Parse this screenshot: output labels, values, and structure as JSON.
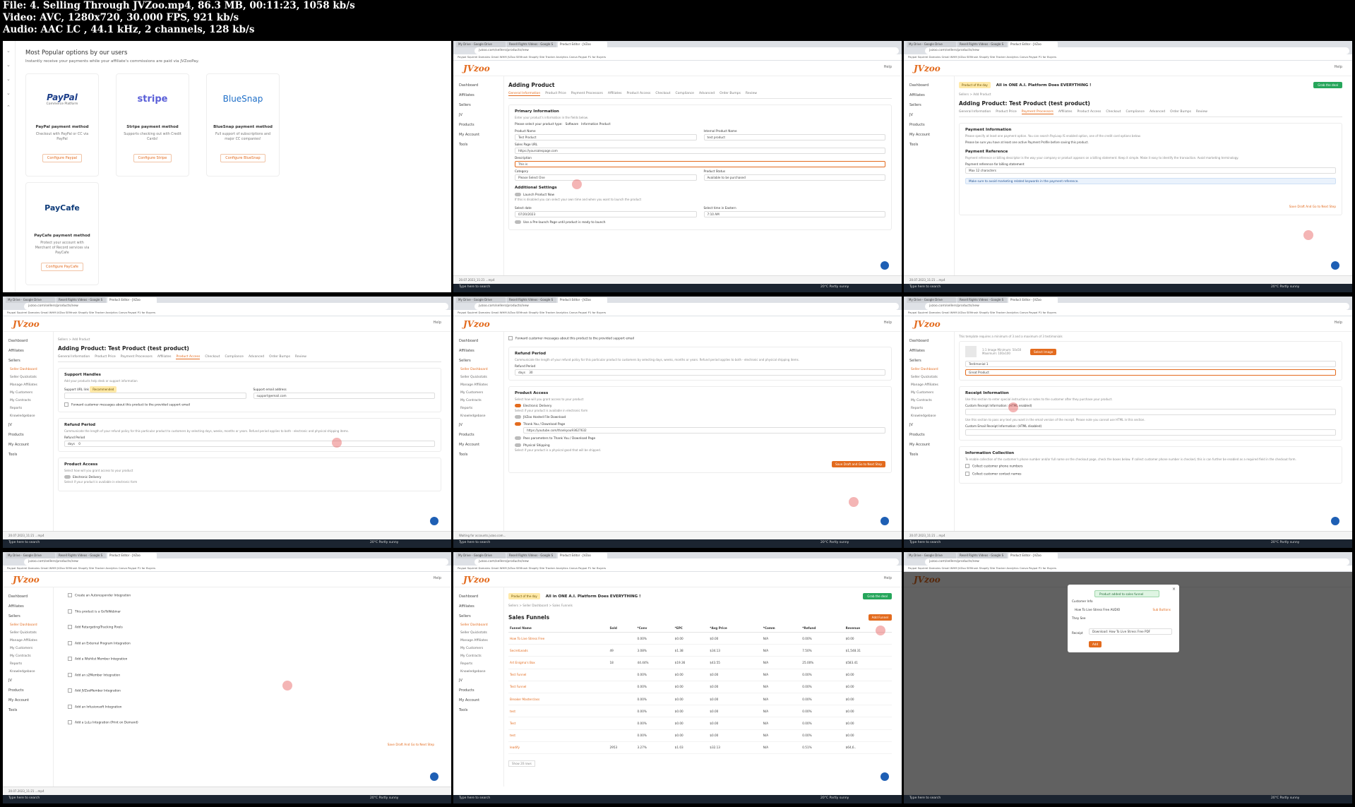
{
  "header": {
    "line1": "File: 4. Selling Through JVZoo.mp4, 86.3 MB, 00:11:23, 1058 kb/s",
    "line2": "Video: AVC, 1280x720, 30.000 FPS, 921 kb/s",
    "line3": "Audio: AAC LC , 44.1 kHz, 2 channels, 128 kb/s"
  },
  "colors": {
    "accent": "#e36b1e",
    "fab": "#1e5fb4",
    "green": "#26a65b"
  },
  "chrome": {
    "tab1": "My Drive - Google Drive",
    "tab2": "Resell Rights Videos - Google S",
    "tab3": "Product Editor - JVZoo",
    "url": "jvzoo.com/sellers/products/new",
    "bookmarks": "Paypal   Squirrel Domains   Gmail   WHM   JVZoo   SEMrush   Shopify   Site Tracker   Analytics   Canva   Paypal P1 for Buyers"
  },
  "app": {
    "logo": "JVzoo",
    "help": "Help"
  },
  "sidebar": {
    "dashboard": "Dashboard",
    "affiliates": "Affiliates",
    "sellers": "Sellers",
    "seller_dashboard": "Seller Dashboard",
    "seller_quickstats": "Seller Quickstats",
    "manage_affiliates": "Manage Affiliates",
    "my_customers": "My Customers",
    "my_contracts": "My Contracts",
    "reports": "Reports",
    "knowledgebase": "Knowledgebase",
    "jv": "JV",
    "products": "Products",
    "my_account": "My Account",
    "tools": "Tools"
  },
  "taskbar": {
    "search": "Type here to search",
    "weather": "20°C  Partly sunny"
  },
  "dlbar": "20.07.2023_11:21 ...mp4",
  "tile1": {
    "title": "Most Popular options by our users",
    "subtitle": "Instantly receive your payments while your affiliate's commissions are paid via JVZooPay.",
    "cards": [
      {
        "logo": "PayPal",
        "logo_sub": "Commerce Platform",
        "name": "PayPal payment method",
        "desc": "Checkout with PayPal or CC via PayPal",
        "cta": "Configure Paypal"
      },
      {
        "logo": "stripe",
        "name": "Stripe payment method",
        "desc": "Supports checking out with Credit Cards!",
        "cta": "Configure Stripe"
      },
      {
        "logo": "BlueSnap",
        "name": "BlueSnap payment method",
        "desc": "Full support of subscriptions and major CC companies!",
        "cta": "Configure BlueSnap"
      },
      {
        "logo": "PayCafe",
        "name": "PayCafe payment method",
        "desc": "Protect your account with Merchant of Record services via PayCafe",
        "cta": "Configure PayCafe"
      }
    ]
  },
  "tile2": {
    "page_title": "Adding Product",
    "tabs": [
      "General Information",
      "Product Price",
      "Payment Processors",
      "Affiliates",
      "Product Access",
      "Checkout",
      "Compliance",
      "Advanced",
      "Order Bumps",
      "Review"
    ],
    "section": "Primary Information",
    "section_desc": "Enter your product's information in the fields below.",
    "product_type_label": "Please select your product type:",
    "type_software": "Software",
    "type_information": "Information Product",
    "product_name_label": "Product Name",
    "product_name": "Test Product",
    "internal_name_label": "Internal Product Name",
    "internal_name": "test product",
    "sales_url_label": "Sales Page URL",
    "sales_url": "https://yoursalespage.com",
    "description_label": "Description",
    "description": "This is",
    "category_label": "Category",
    "category": "Please Select One",
    "status_label": "Product Status",
    "status": "Available to be purchased",
    "additional": "Additional Settings",
    "launch_now": "Launch Product Now",
    "launch_desc": "If this is disabled you can select your own time and when you want to launch the product",
    "date_label": "Select date",
    "date": "07/20/2023",
    "time_label": "Select time in Eastern",
    "time": "7:10 AM",
    "prelaunch": "Use a Pre-launch Page until product is ready to launch"
  },
  "tile3": {
    "badge": "Product of the day",
    "banner": "All in ONE A.I. Platform Does EVERYTHING !",
    "banner_btn": "Grab the deal",
    "crumb": "Sellers  >  Add Product",
    "page_title": "Adding Product: Test Product (test product)",
    "tabs": [
      "General Information",
      "Product Price",
      "Payment Processors",
      "Affiliates",
      "Product Access",
      "Checkout",
      "Compliance",
      "Advanced",
      "Order Bumps",
      "Review"
    ],
    "pi_title": "Payment Information",
    "pi_desc": "Please specify at least one payment option. You can search PayLoop IS enabled option, one of the credit card options below.",
    "pi_desc2": "Please be sure you have at least one active Payment Profile before saving this product.",
    "pr_title": "Payment Reference",
    "pr_desc": "Payment reference or billing descriptor is the way your company or product appears on a billing statement. Keep it simple. Make it easy to identify the transaction. Avoid marketing terminology.",
    "pr_label": "Payment reference for billing statement",
    "pr_placeholder": "Max 12 characters",
    "pr_note": "Make sure to avoid marketing related keywords in the payment reference.",
    "save": "Save Draft And Go to Next Step"
  },
  "tile4": {
    "crumb": "Sellers  >  Add Product",
    "page_title": "Adding Product: Test Product (test product)",
    "tabs": [
      "General Information",
      "Product Price",
      "Payment Processors",
      "Affiliates",
      "Product Access",
      "Checkout",
      "Compliance",
      "Advanced",
      "Order Bumps",
      "Review"
    ],
    "sh_title": "Support Handles",
    "sh_desc": "Add your products help desk or support information",
    "url_label": "Support URL link",
    "url_tag": "Recommended",
    "email_label": "Support email address",
    "email_placeholder": "support@email.com",
    "forward": "Forward customer messages about this product to the provided support email",
    "rp_title": "Refund Period",
    "rp_desc": "Communicate the length of your refund policy for this particular product to customers by selecting days, weeks, months or years. Refund period applies to both - electronic and physical shipping items.",
    "rp_label": "Refund Period",
    "rp_unit": "days",
    "rp_value": "0",
    "pa_title": "Product Access",
    "pa_desc": "Select how will you grant access to your product",
    "electronic": "Electronic Delivery",
    "electronic_desc": "Select if your product is available in electronic form"
  },
  "tile5": {
    "forward": "Forward customer messages about this product to the provided support email",
    "rp_title": "Refund Period",
    "rp_desc": "Communicate the length of your refund policy for this particular product to customers by selecting days, weeks, months or years. Refund period applies to both - electronic and physical shipping items.",
    "rp_label": "Refund Period",
    "rp_unit": "days",
    "rp_value": "30",
    "pa_title": "Product Access",
    "pa_desc": "Select how will you grant access to your product",
    "electronic": "Electronic Delivery",
    "electronic_desc": "Select if your product is available in electronic form",
    "hosted": "JVZoo Hosted File Download",
    "thankyou": "Thank You / Download Page",
    "thankyou_url": "https://youtube.com/thankyou93627632",
    "pass": "Pass parameters to Thank You / Download Page",
    "physical": "Physical Shipping",
    "physical_desc": "Select if your product is a physical good that will be shipped.",
    "save": "Save Draft and Go to Next Step",
    "status": "Waiting for accounts.jvzoo.com..."
  },
  "tile6": {
    "img_note": "This template requires a minimum of 3 and a maximum of 3 testimonials",
    "img_size": "1:1 Image  Minimum: 50x50  Maximum: 100x100",
    "select_image": "Select Image",
    "testimonial": "Testimonial 1",
    "great": "Great Product",
    "ri_title": "Receipt Information",
    "ri_desc": "Use this section to enter special instructions or notes to the customer after they purchase your product.",
    "ri_html_label": "Custom Receipt Information: (HTML enabled)",
    "ri_desc2": "Use this section to pass any text you want in the email version of the receipt. Please note you cannot use HTML in this section.",
    "ri_text_label": "Custom Email Receipt Information: (HTML disabled)",
    "ic_title": "Information Collection",
    "ic_desc": "To enable collection of the customer's phone number and/or full name on the checkout page, check the boxes below. If collect customer phone number is checked, this is can further be enabled as a required field in the checkout form.",
    "phone": "Collect customer phone numbers",
    "contact": "Collect customer contact names"
  },
  "tile7": {
    "items": [
      "Create an Autoresponder Integration",
      "This product is a GoToWebinar",
      "Add Retargeting/Tracking Pixels",
      "Add an External Program Integration",
      "Add a Wishlist Member Integration",
      "Add an s2Member Integration",
      "Add JVZooMember Integration",
      "Add an Infusionsoft Integration",
      "Add a LuLu Integration (Print on Demand)"
    ],
    "save": "Save Draft And Go to Next Step"
  },
  "tile8": {
    "badge": "Product of the day",
    "banner": "All in ONE A.I. Platform Does EVERYTHING !",
    "banner_btn": "Grab the deal",
    "crumb": "Sellers  >  Seller Dashboard  >  Sales Funnels",
    "page_title": "Sales Funnels",
    "add_btn": "Add Funnel",
    "headers": [
      "Funnel Name",
      "Sold",
      "*Conv",
      "*EPC",
      "*Avg Price",
      "*Comm",
      "*Refund",
      "Revenue"
    ],
    "rows": [
      [
        "How To Live Stress Free",
        "",
        "0.00%",
        "$0.00",
        "$0.00",
        "N/A",
        "0.00%",
        "$0.00"
      ],
      [
        "SecretLeads",
        "49",
        "3.08%",
        "$1.38",
        "$34.13",
        "N/A",
        "7.50%",
        "$1,548.31"
      ],
      [
        "Art Enigma's Box",
        "18",
        "44.44%",
        "$19.36",
        "$43.55",
        "N/A",
        "25.00%",
        "$583.41"
      ],
      [
        "Test Funnel",
        "",
        "0.00%",
        "$0.00",
        "$0.00",
        "N/A",
        "0.00%",
        "$0.00"
      ],
      [
        "Test Funnel",
        "",
        "0.00%",
        "$0.00",
        "$0.00",
        "N/A",
        "0.00%",
        "$0.00"
      ],
      [
        "Breaker Masterclass",
        "",
        "0.00%",
        "$0.00",
        "$0.00",
        "N/A",
        "0.00%",
        "$0.00"
      ],
      [
        "test",
        "",
        "0.00%",
        "$0.00",
        "$0.00",
        "N/A",
        "0.00%",
        "$0.00"
      ],
      [
        "Test",
        "",
        "0.00%",
        "$0.00",
        "$0.00",
        "N/A",
        "0.00%",
        "$0.00"
      ],
      [
        "test",
        "",
        "0.00%",
        "$0.00",
        "$0.00",
        "N/A",
        "0.00%",
        "$0.00"
      ],
      [
        "leadify",
        "2953",
        "3.27%",
        "$1.03",
        "$32.13",
        "N/A",
        "0.51%",
        "$64,6.."
      ]
    ],
    "show_rows": "Show 20 rows"
  },
  "tile9": {
    "toast": "Product added to sales funnel",
    "customer_label": "Customer Info",
    "funnel_product": "How To Live Stress Free AUDIO",
    "sub_btn": "Sub Buttons",
    "they_see": "They See",
    "receipt_label": "Receipt",
    "receipt_value": "Download: How To Live Stress Free PDF",
    "add_btn": "Add"
  }
}
